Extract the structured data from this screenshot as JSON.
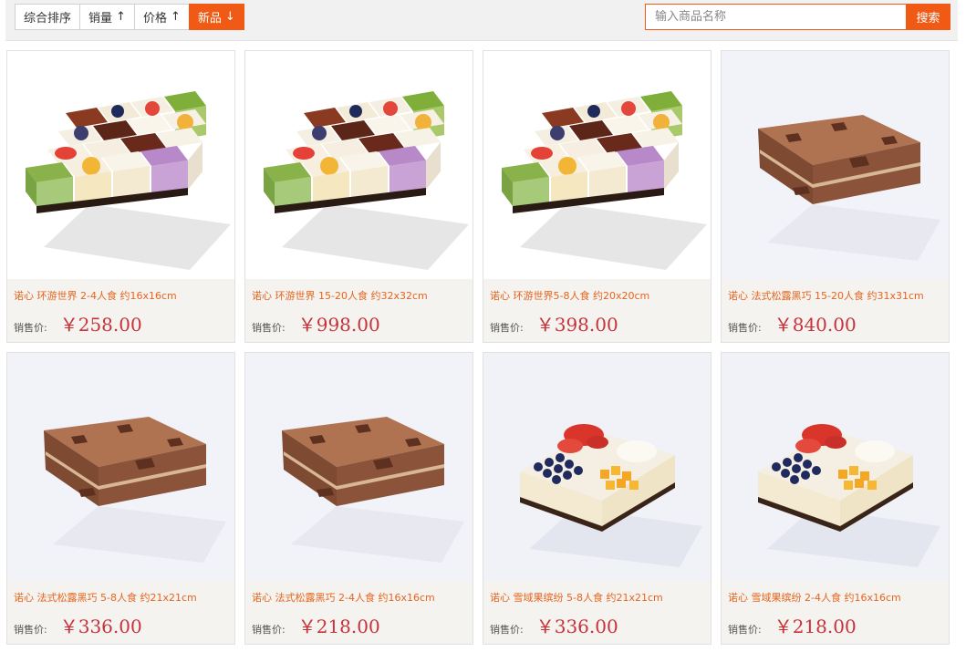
{
  "sort_bar": {
    "items": [
      {
        "label": "综合排序",
        "arrow": ""
      },
      {
        "label": "销量",
        "arrow": "↑"
      },
      {
        "label": "价格",
        "arrow": "↑"
      },
      {
        "label": "新品",
        "arrow": "↓"
      }
    ],
    "active_index": 3
  },
  "search": {
    "placeholder": "输入商品名称",
    "button_label": "搜索"
  },
  "price_label": "销售价:",
  "products": [
    {
      "name": "诺心 环游世界 2-4人食 约16x16cm",
      "price": "￥258.00",
      "image": "tile-cake-icon"
    },
    {
      "name": "诺心 环游世界 15-20人食 约32x32cm",
      "price": "￥998.00",
      "image": "tile-cake-icon"
    },
    {
      "name": "诺心 环游世界5-8人食 约20x20cm",
      "price": "￥398.00",
      "image": "tile-cake-icon"
    },
    {
      "name": "诺心 法式松露黑巧 15-20人食 约31x31cm",
      "price": "￥840.00",
      "image": "tiramisu-cake-icon"
    },
    {
      "name": "诺心 法式松露黑巧 5-8人食 约21x21cm",
      "price": "￥336.00",
      "image": "tiramisu-cake-icon"
    },
    {
      "name": "诺心 法式松露黑巧 2-4人食 约16x16cm",
      "price": "￥218.00",
      "image": "tiramisu-cake-icon"
    },
    {
      "name": "诺心 雪域果缤纷 5-8人食 约21x21cm",
      "price": "￥336.00",
      "image": "fruit-cake-icon"
    },
    {
      "name": "诺心 雪域果缤纷 2-4人食 约16x16cm",
      "price": "￥218.00",
      "image": "fruit-cake-icon"
    }
  ],
  "colors": {
    "accent": "#f05a14",
    "name_text": "#e8641e",
    "price_text": "#c8323a",
    "info_bg": "#f4f3ef"
  }
}
